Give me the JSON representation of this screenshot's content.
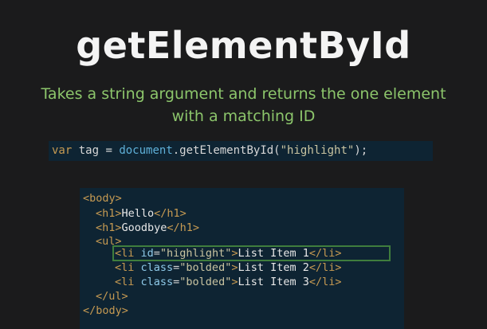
{
  "slide": {
    "title": "getElementById",
    "subtitle": "Takes a string argument and returns the one element with a matching ID"
  },
  "snippet": {
    "kw": "var",
    "mid": " tag = ",
    "obj": "document",
    "method": ".getElementById(",
    "arg": "\"highlight\"",
    "end": ");"
  },
  "html_code": {
    "body_open": "<body>",
    "h1_hello_open": "<h1>",
    "h1_hello_text": "Hello",
    "h1_hello_close": "</h1>",
    "h1_goodbye_open": "<h1>",
    "h1_goodbye_text": "Goodbye",
    "h1_goodbye_close": "</h1>",
    "ul_open": "<ul>",
    "li1_tag": "<li ",
    "li1_attr": "id",
    "li1_eq": "=",
    "li1_val": "\"highlight\"",
    "li1_gt": ">",
    "li1_text": "List Item 1",
    "li1_close": "</li>",
    "li2_tag": "<li ",
    "li2_attr": "class",
    "li2_eq": "=",
    "li2_val": "\"bolded\"",
    "li2_gt": ">",
    "li2_text": "List Item 2",
    "li2_close": "</li>",
    "li3_tag": "<li ",
    "li3_attr": "class",
    "li3_eq": "=",
    "li3_val": "\"bolded\"",
    "li3_gt": ">",
    "li3_text": "List Item 3",
    "li3_close": "</li>",
    "ul_close": "</ul>",
    "body_close": "</body>"
  },
  "colors": {
    "background": "#1b1b1c",
    "accent_green": "#8cc56b",
    "code_bg": "#0e2433",
    "highlight_border": "#3f7d3d"
  }
}
